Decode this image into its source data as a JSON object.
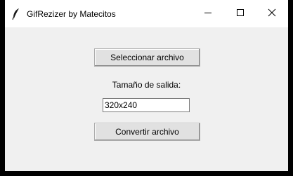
{
  "window": {
    "title": "GifRezizer by Matecitos",
    "app_icon": "feather-icon",
    "controls": {
      "minimize_icon": "minimize-icon",
      "maximize_icon": "maximize-icon",
      "close_icon": "close-icon"
    }
  },
  "main": {
    "select_button_label": "Seleccionar archivo",
    "size_label": "Tamaño de salida:",
    "size_input_value": "320x240",
    "convert_button_label": "Convertir archivo"
  }
}
